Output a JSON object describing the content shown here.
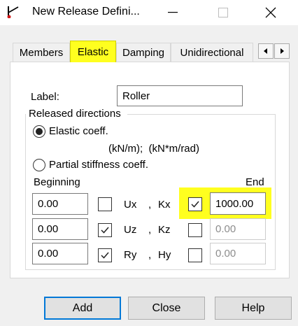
{
  "window": {
    "title": "New Release Defini...",
    "minimize_glyph": "—",
    "close_glyph": "✕"
  },
  "tabs": [
    "Members",
    "Elastic",
    "Damping",
    "Unidirectional"
  ],
  "active_tab": "Elastic",
  "form": {
    "label_caption": "Label:",
    "label_value": "Roller",
    "group_title": "Released directions",
    "elastic_option": "Elastic coeff.",
    "elastic_selected": true,
    "units_text": "(kN/m);  (kN*m/rad)",
    "partial_option": "Partial stiffness coeff.",
    "beginning_header": "Beginning",
    "end_header": "End"
  },
  "rows": [
    {
      "begin_value": "0.00",
      "begin_checked": false,
      "dir1": "Ux",
      "sep": ",",
      "dir2": "Kx",
      "end_checked": true,
      "end_value": "1000.00",
      "end_enabled": true
    },
    {
      "begin_value": "0.00",
      "begin_checked": true,
      "dir1": "Uz",
      "sep": ",",
      "dir2": "Kz",
      "end_checked": false,
      "end_value": "0.00",
      "end_enabled": false
    },
    {
      "begin_value": "0.00",
      "begin_checked": true,
      "dir1": "Ry",
      "sep": ",",
      "dir2": "Hy",
      "end_checked": false,
      "end_value": "0.00",
      "end_enabled": false
    }
  ],
  "buttons": {
    "add": "Add",
    "close": "Close",
    "help": "Help"
  },
  "colors": {
    "highlight": "#ffff1f",
    "default_button_border": "#0078d7",
    "panel": "#ffffff",
    "dialog": "#f0f0f0"
  }
}
